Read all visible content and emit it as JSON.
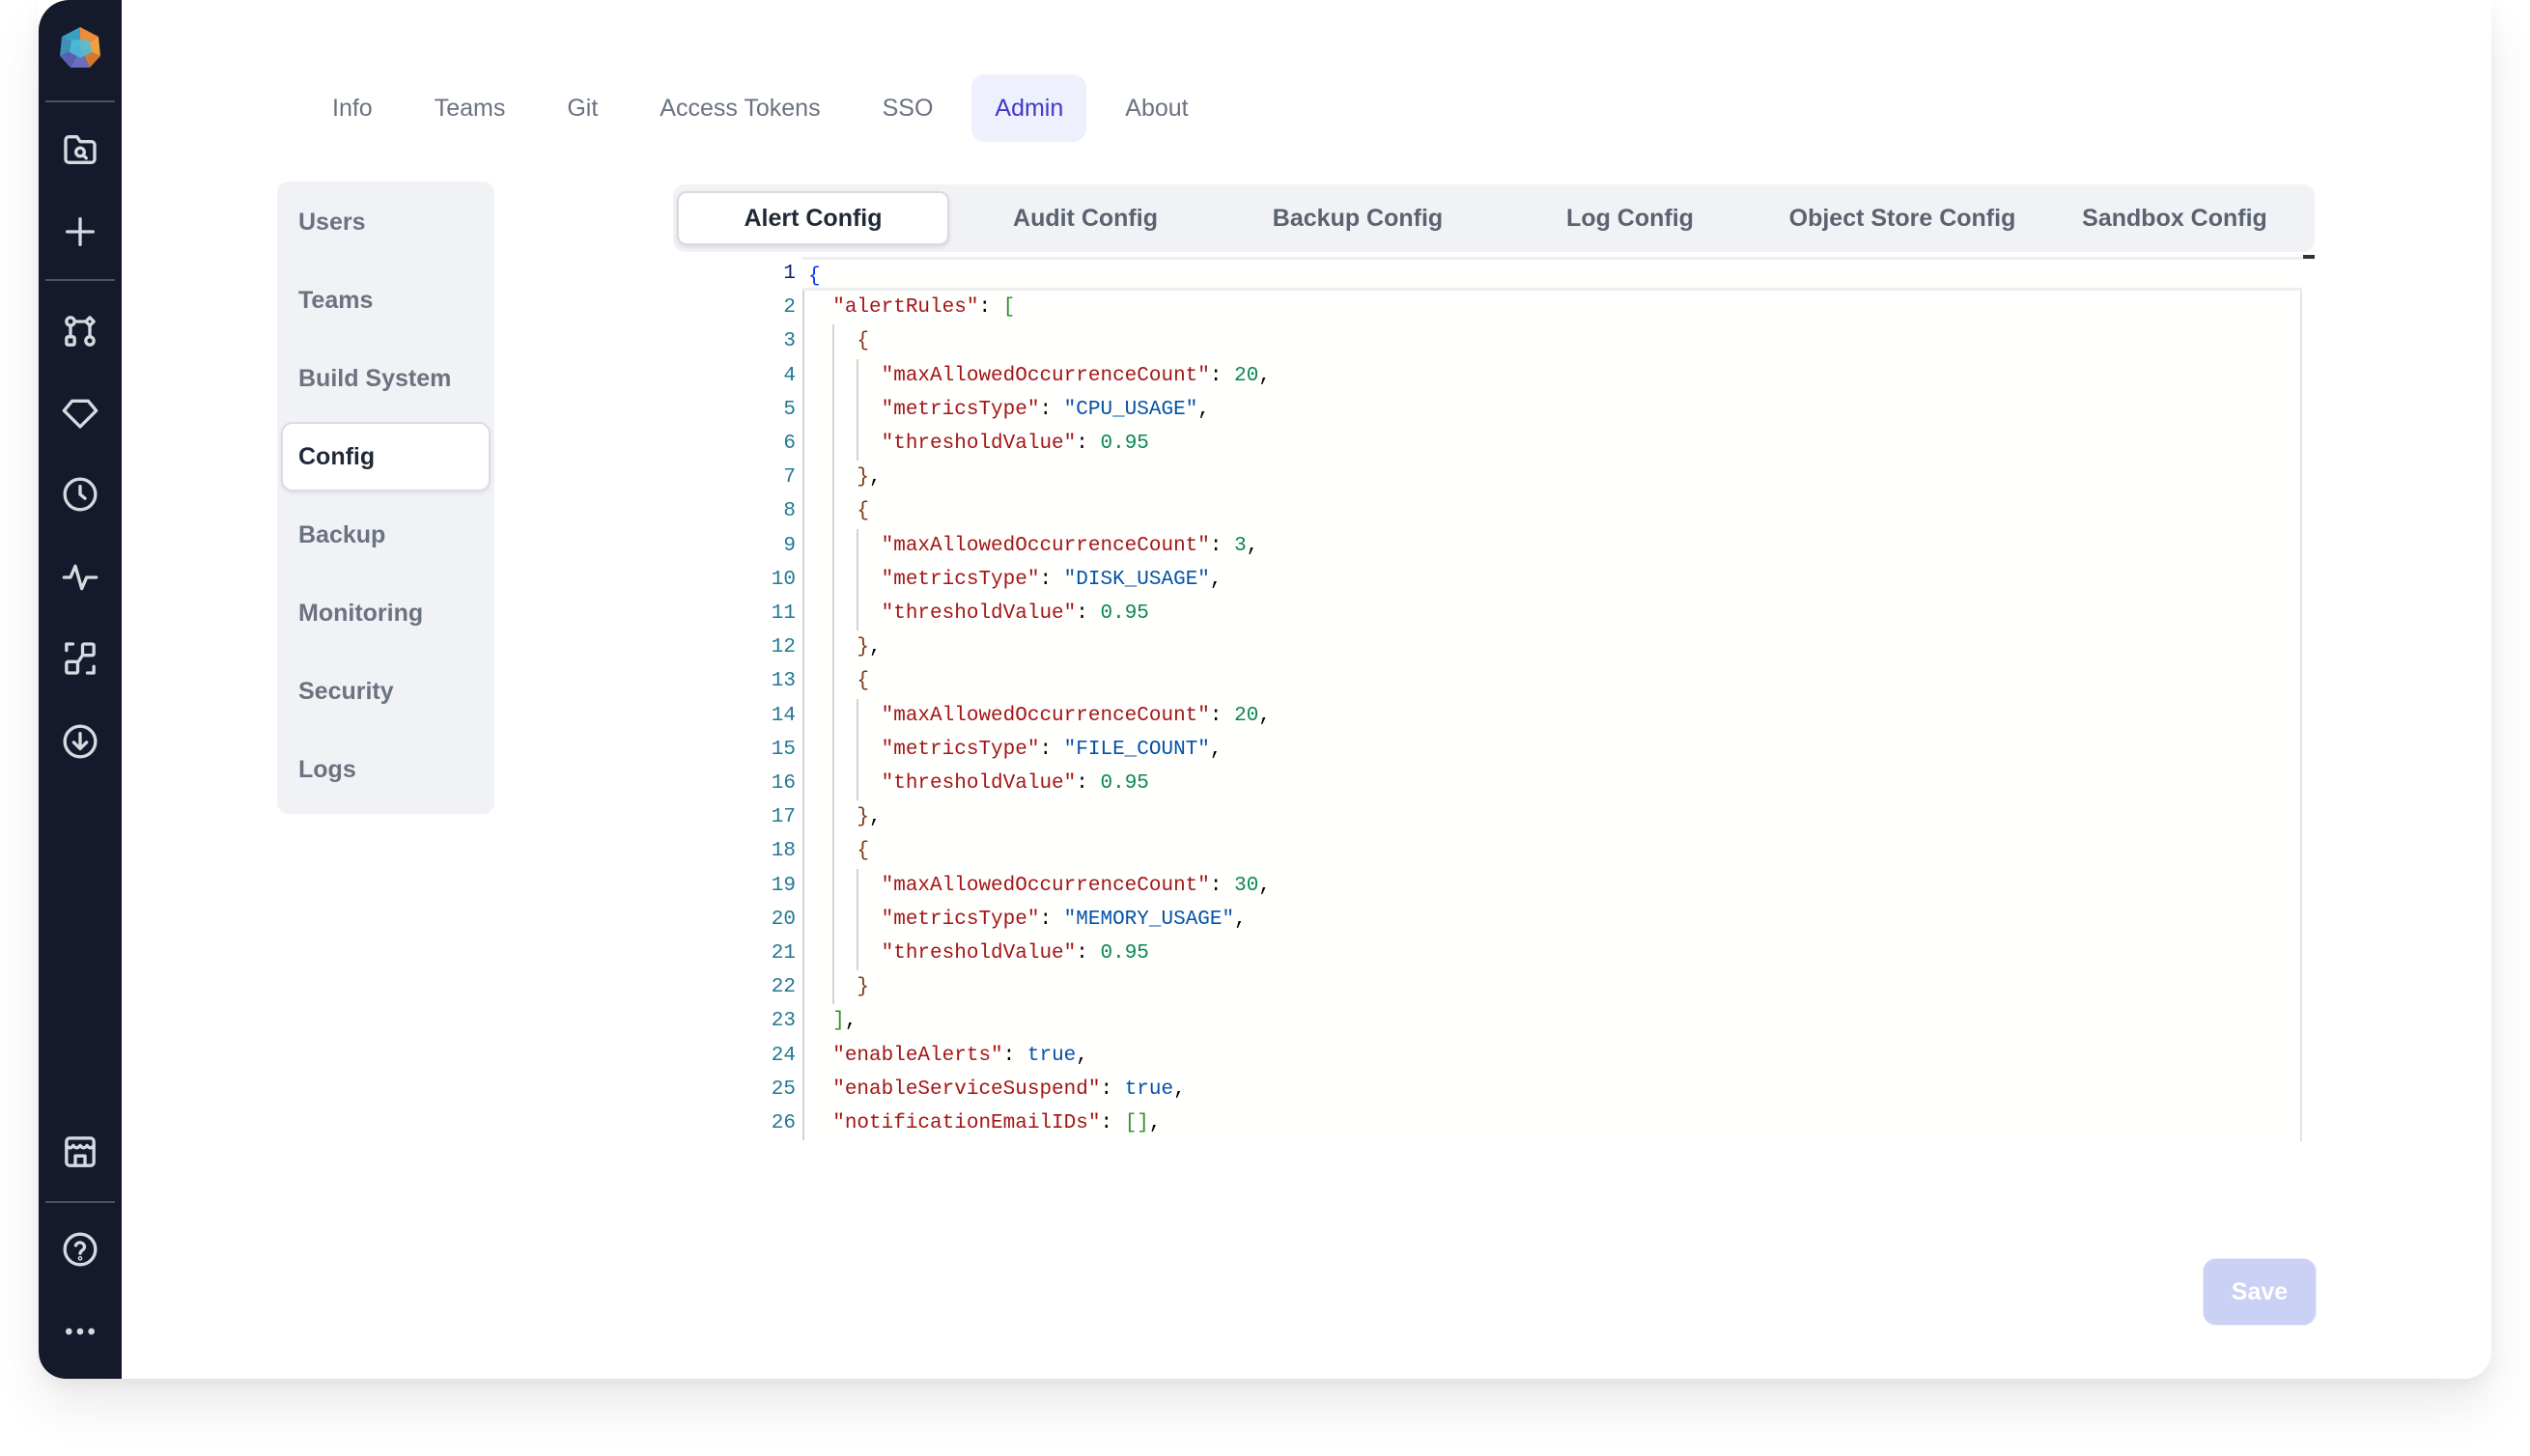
{
  "rail": {
    "logo": "prophecy-hexagon-logo",
    "icons": [
      {
        "name": "folder-search-icon",
        "label": "Browse"
      },
      {
        "name": "plus-icon",
        "label": "Create"
      },
      {
        "name": "pipeline-icon",
        "label": "Pipelines"
      },
      {
        "name": "gem-icon",
        "label": "Gems"
      },
      {
        "name": "clock-icon",
        "label": "Schedules"
      },
      {
        "name": "activity-icon",
        "label": "Observability"
      },
      {
        "name": "lineage-icon",
        "label": "Lineage"
      },
      {
        "name": "download-circle-icon",
        "label": "Downloads"
      },
      {
        "name": "storefront-icon",
        "label": "Marketplace"
      },
      {
        "name": "help-circle-icon",
        "label": "Help"
      },
      {
        "name": "more-horizontal-icon",
        "label": "More"
      }
    ]
  },
  "top_tabs": [
    {
      "label": "Info",
      "active": false
    },
    {
      "label": "Teams",
      "active": false
    },
    {
      "label": "Git",
      "active": false
    },
    {
      "label": "Access Tokens",
      "active": false
    },
    {
      "label": "SSO",
      "active": false
    },
    {
      "label": "Admin",
      "active": true
    },
    {
      "label": "About",
      "active": false
    }
  ],
  "side_menu": [
    {
      "label": "Users",
      "active": false
    },
    {
      "label": "Teams",
      "active": false
    },
    {
      "label": "Build System",
      "active": false
    },
    {
      "label": "Config",
      "active": true
    },
    {
      "label": "Backup",
      "active": false
    },
    {
      "label": "Monitoring",
      "active": false
    },
    {
      "label": "Security",
      "active": false
    },
    {
      "label": "Logs",
      "active": false
    }
  ],
  "config_tabs": [
    {
      "label": "Alert Config",
      "active": true
    },
    {
      "label": "Audit Config",
      "active": false
    },
    {
      "label": "Backup Config",
      "active": false
    },
    {
      "label": "Log Config",
      "active": false
    },
    {
      "label": "Object Store Config",
      "active": false
    },
    {
      "label": "Sandbox Config",
      "active": false
    }
  ],
  "editor": {
    "current_line": 1,
    "lines": [
      {
        "n": 1,
        "indent": 0,
        "tokens": [
          [
            "brace0",
            "{"
          ]
        ]
      },
      {
        "n": 2,
        "indent": 1,
        "tokens": [
          [
            "key",
            "\"alertRules\""
          ],
          [
            "punc",
            ": "
          ],
          [
            "brace1",
            "["
          ]
        ]
      },
      {
        "n": 3,
        "indent": 2,
        "tokens": [
          [
            "brace2",
            "{"
          ]
        ]
      },
      {
        "n": 4,
        "indent": 3,
        "tokens": [
          [
            "key",
            "\"maxAllowedOccurrenceCount\""
          ],
          [
            "punc",
            ": "
          ],
          [
            "num",
            "20"
          ],
          [
            "punc",
            ","
          ]
        ]
      },
      {
        "n": 5,
        "indent": 3,
        "tokens": [
          [
            "key",
            "\"metricsType\""
          ],
          [
            "punc",
            ": "
          ],
          [
            "str",
            "\"CPU_USAGE\""
          ],
          [
            "punc",
            ","
          ]
        ]
      },
      {
        "n": 6,
        "indent": 3,
        "tokens": [
          [
            "key",
            "\"thresholdValue\""
          ],
          [
            "punc",
            ": "
          ],
          [
            "num",
            "0.95"
          ]
        ]
      },
      {
        "n": 7,
        "indent": 2,
        "tokens": [
          [
            "brace2",
            "}"
          ],
          [
            "punc",
            ","
          ]
        ]
      },
      {
        "n": 8,
        "indent": 2,
        "tokens": [
          [
            "brace2",
            "{"
          ]
        ]
      },
      {
        "n": 9,
        "indent": 3,
        "tokens": [
          [
            "key",
            "\"maxAllowedOccurrenceCount\""
          ],
          [
            "punc",
            ": "
          ],
          [
            "num",
            "3"
          ],
          [
            "punc",
            ","
          ]
        ]
      },
      {
        "n": 10,
        "indent": 3,
        "tokens": [
          [
            "key",
            "\"metricsType\""
          ],
          [
            "punc",
            ": "
          ],
          [
            "str",
            "\"DISK_USAGE\""
          ],
          [
            "punc",
            ","
          ]
        ]
      },
      {
        "n": 11,
        "indent": 3,
        "tokens": [
          [
            "key",
            "\"thresholdValue\""
          ],
          [
            "punc",
            ": "
          ],
          [
            "num",
            "0.95"
          ]
        ]
      },
      {
        "n": 12,
        "indent": 2,
        "tokens": [
          [
            "brace2",
            "}"
          ],
          [
            "punc",
            ","
          ]
        ]
      },
      {
        "n": 13,
        "indent": 2,
        "tokens": [
          [
            "brace2",
            "{"
          ]
        ]
      },
      {
        "n": 14,
        "indent": 3,
        "tokens": [
          [
            "key",
            "\"maxAllowedOccurrenceCount\""
          ],
          [
            "punc",
            ": "
          ],
          [
            "num",
            "20"
          ],
          [
            "punc",
            ","
          ]
        ]
      },
      {
        "n": 15,
        "indent": 3,
        "tokens": [
          [
            "key",
            "\"metricsType\""
          ],
          [
            "punc",
            ": "
          ],
          [
            "str",
            "\"FILE_COUNT\""
          ],
          [
            "punc",
            ","
          ]
        ]
      },
      {
        "n": 16,
        "indent": 3,
        "tokens": [
          [
            "key",
            "\"thresholdValue\""
          ],
          [
            "punc",
            ": "
          ],
          [
            "num",
            "0.95"
          ]
        ]
      },
      {
        "n": 17,
        "indent": 2,
        "tokens": [
          [
            "brace2",
            "}"
          ],
          [
            "punc",
            ","
          ]
        ]
      },
      {
        "n": 18,
        "indent": 2,
        "tokens": [
          [
            "brace2",
            "{"
          ]
        ]
      },
      {
        "n": 19,
        "indent": 3,
        "tokens": [
          [
            "key",
            "\"maxAllowedOccurrenceCount\""
          ],
          [
            "punc",
            ": "
          ],
          [
            "num",
            "30"
          ],
          [
            "punc",
            ","
          ]
        ]
      },
      {
        "n": 20,
        "indent": 3,
        "tokens": [
          [
            "key",
            "\"metricsType\""
          ],
          [
            "punc",
            ": "
          ],
          [
            "str",
            "\"MEMORY_USAGE\""
          ],
          [
            "punc",
            ","
          ]
        ]
      },
      {
        "n": 21,
        "indent": 3,
        "tokens": [
          [
            "key",
            "\"thresholdValue\""
          ],
          [
            "punc",
            ": "
          ],
          [
            "num",
            "0.95"
          ]
        ]
      },
      {
        "n": 22,
        "indent": 2,
        "tokens": [
          [
            "brace2",
            "}"
          ]
        ]
      },
      {
        "n": 23,
        "indent": 1,
        "tokens": [
          [
            "brace1",
            "]"
          ],
          [
            "punc",
            ","
          ]
        ]
      },
      {
        "n": 24,
        "indent": 1,
        "tokens": [
          [
            "key",
            "\"enableAlerts\""
          ],
          [
            "punc",
            ": "
          ],
          [
            "bool",
            "true"
          ],
          [
            "punc",
            ","
          ]
        ]
      },
      {
        "n": 25,
        "indent": 1,
        "tokens": [
          [
            "key",
            "\"enableServiceSuspend\""
          ],
          [
            "punc",
            ": "
          ],
          [
            "bool",
            "true"
          ],
          [
            "punc",
            ","
          ]
        ]
      },
      {
        "n": 26,
        "indent": 1,
        "tokens": [
          [
            "key",
            "\"notificationEmailIDs\""
          ],
          [
            "punc",
            ": "
          ],
          [
            "brace1",
            "[]"
          ],
          [
            "punc",
            ","
          ]
        ]
      }
    ]
  },
  "actions": {
    "save_label": "Save",
    "save_enabled": false
  },
  "colors": {
    "accent": "#4338ca",
    "accent_bg": "#eef0fd",
    "rail_bg": "#141a2b",
    "save_disabled_bg": "#cbd1f5",
    "json_key": "#a31515",
    "json_string": "#0451a5",
    "json_number": "#098658"
  }
}
